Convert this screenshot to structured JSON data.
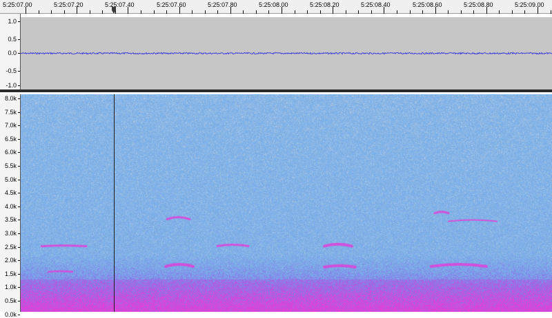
{
  "timeline": {
    "labels": [
      "5:25:07.00",
      "5:25:07.20",
      "5:25:07.40",
      "5:25:07.60",
      "5:25:07.80",
      "5:25:08.00",
      "5:25:08.20",
      "5:25:08.40",
      "5:25:08.60",
      "5:25:08.80",
      "5:25:09.00"
    ]
  },
  "waveform": {
    "scale_labels": [
      "1.0",
      "0.5",
      "0.0",
      "-0.5",
      "-1.0"
    ],
    "background_color": "#c6c6c6",
    "wave_color": "#3a3adc"
  },
  "spectrogram": {
    "freq_labels": [
      "8.0k",
      "7.5k",
      "7.0k",
      "6.5k",
      "6.0k",
      "5.5k",
      "5.0k",
      "4.5k",
      "4.0k",
      "3.5k",
      "3.0k",
      "2.5k",
      "2.0k",
      "1.5k",
      "1.0k",
      "0.5k",
      "0.0k"
    ],
    "colors": {
      "low": "#78aee8",
      "mid": "#8a78e8",
      "high": "#e040d8",
      "grain": "#c8d4e0"
    }
  },
  "playhead": {
    "time": "5:25:07.40"
  }
}
